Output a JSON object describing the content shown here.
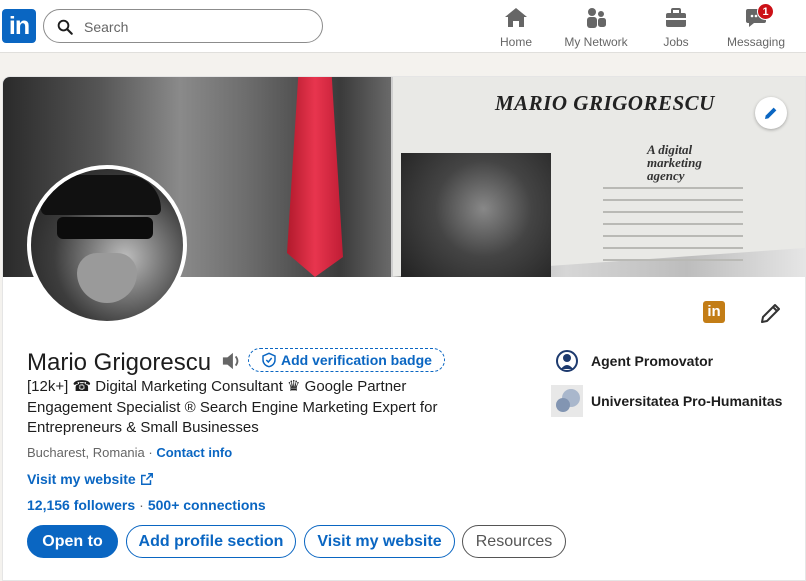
{
  "nav": {
    "logo_text": "in",
    "search_placeholder": "Search",
    "items": [
      {
        "label": "Home",
        "icon": "home-icon"
      },
      {
        "label": "My Network",
        "icon": "network-icon"
      },
      {
        "label": "Jobs",
        "icon": "briefcase-icon"
      },
      {
        "label": "Messaging",
        "icon": "messaging-icon",
        "badge": "1"
      }
    ]
  },
  "banner": {
    "newspaper_title": "MARIO GRIGORESCU",
    "newspaper_subtitle": "A digital marketing agency"
  },
  "profile": {
    "name": "Mario Grigorescu",
    "verification_label": "Add verification badge",
    "headline": "[12k+] ☎ Digital Marketing Consultant ♛ Google Partner Engagement Specialist ® Search Engine Marketing Expert for Entrepreneurs & Small Businesses",
    "location": "Bucharest, Romania",
    "separator": " · ",
    "contact_info": "Contact info",
    "website_link": "Visit my website",
    "followers": "12,156 followers",
    "connections": "500+ connections"
  },
  "side": {
    "company": "Agent Promovator",
    "school": "Universitatea Pro-Humanitas",
    "company_logo_text": "in"
  },
  "actions": {
    "open_to": "Open to",
    "add_section": "Add profile section",
    "visit_website": "Visit my website",
    "resources": "Resources"
  },
  "colors": {
    "brand": "#0a66c2",
    "badge": "#cc1016",
    "company_logo": "#c37d16"
  }
}
